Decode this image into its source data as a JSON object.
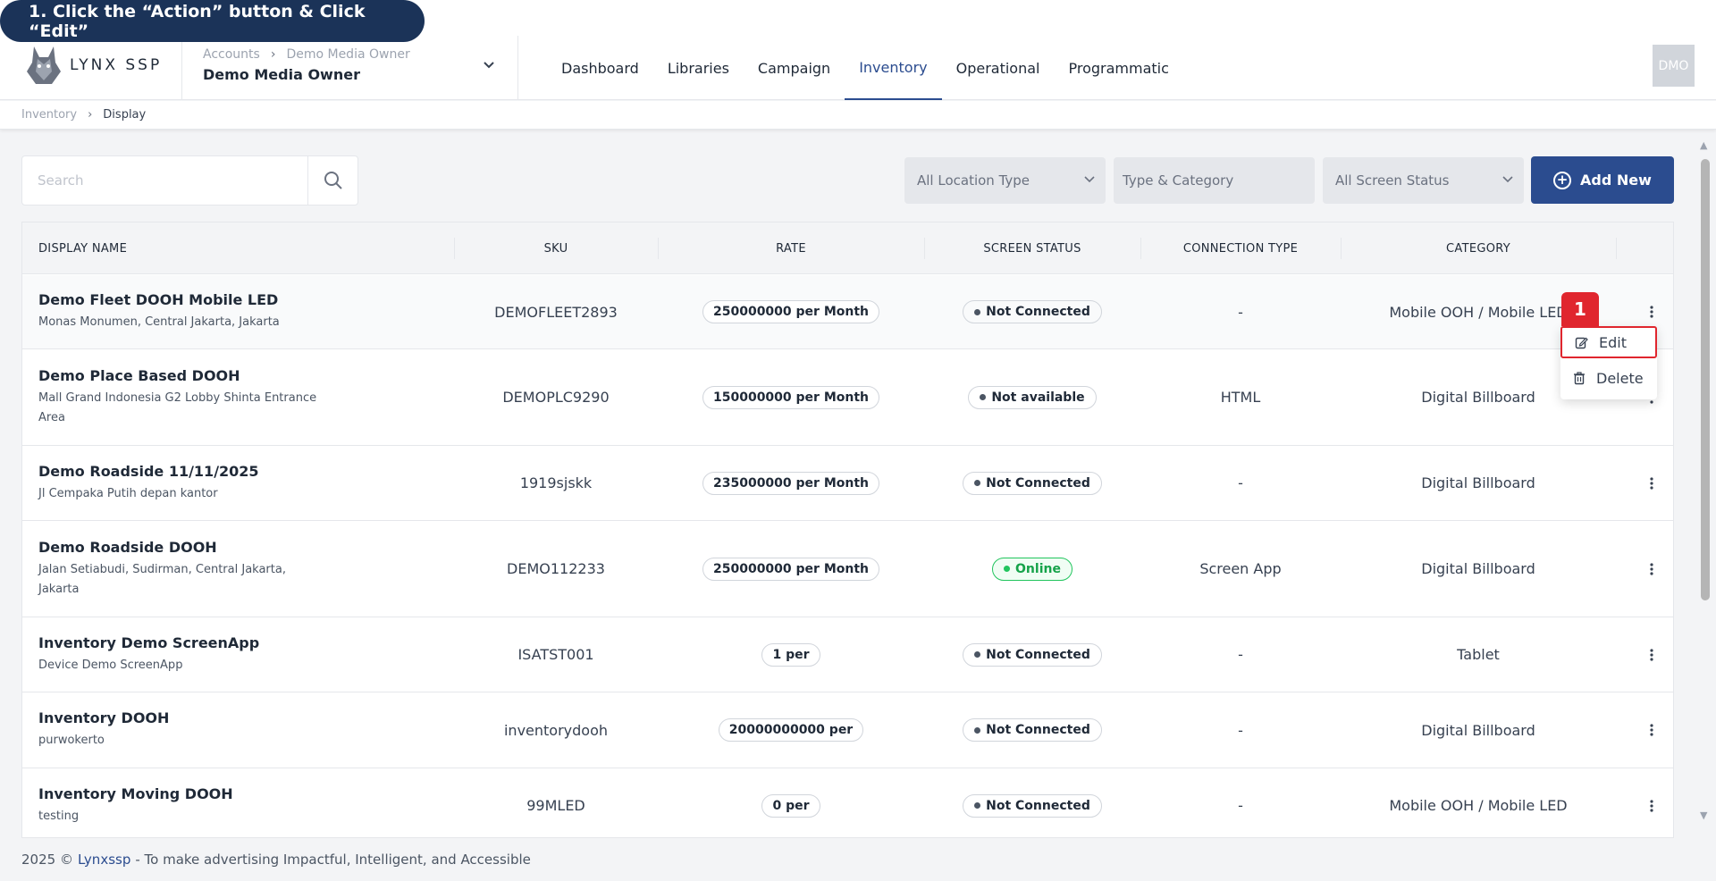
{
  "banner": {
    "text": "1. Click the “Action” button & Click “Edit”"
  },
  "header": {
    "logo_text": "LYNX SSP",
    "account_breadcrumb": [
      "Accounts",
      "Demo Media Owner"
    ],
    "account_name": "Demo Media Owner",
    "nav": [
      "Dashboard",
      "Libraries",
      "Campaign",
      "Inventory",
      "Operational",
      "Programmatic"
    ],
    "active_nav": "Inventory",
    "avatar_text": "DMO"
  },
  "breadcrumb": {
    "parent": "Inventory",
    "current": "Display"
  },
  "toolbar": {
    "search_placeholder": "Search",
    "filter_location": "All Location Type",
    "filter_category": "Type & Category",
    "filter_status": "All Screen Status",
    "add_new": "Add New"
  },
  "table": {
    "headers": [
      "DISPLAY NAME",
      "SKU",
      "RATE",
      "SCREEN STATUS",
      "CONNECTION TYPE",
      "CATEGORY"
    ],
    "rows": [
      {
        "name": "Demo Fleet DOOH Mobile LED",
        "location": "Monas Monumen, Central Jakarta, Jakarta",
        "sku": "DEMOFLEET2893",
        "rate": "250000000 per Month",
        "status": "Not Connected",
        "connection": "-",
        "category": "Mobile OOH / Mobile LED"
      },
      {
        "name": "Demo Place Based DOOH",
        "location": "Mall Grand Indonesia G2 Lobby Shinta Entrance Area",
        "sku": "DEMOPLC9290",
        "rate": "150000000 per Month",
        "status": "Not available",
        "connection": "HTML",
        "category": "Digital Billboard"
      },
      {
        "name": "Demo Roadside 11/11/2025",
        "location": "Jl Cempaka Putih depan kantor",
        "sku": "1919sjskk",
        "rate": "235000000 per Month",
        "status": "Not Connected",
        "connection": "-",
        "category": "Digital Billboard"
      },
      {
        "name": "Demo Roadside DOOH",
        "location": "Jalan Setiabudi, Sudirman, Central Jakarta, Jakarta",
        "sku": "DEMO112233",
        "rate": "250000000 per Month",
        "status": "Online",
        "connection": "Screen App",
        "category": "Digital Billboard"
      },
      {
        "name": "Inventory Demo ScreenApp",
        "location": "Device Demo ScreenApp",
        "sku": "ISATST001",
        "rate": "1 per",
        "status": "Not Connected",
        "connection": "-",
        "category": "Tablet"
      },
      {
        "name": "Inventory DOOH",
        "location": "purwokerto",
        "sku": "inventorydooh",
        "rate": "20000000000 per",
        "status": "Not Connected",
        "connection": "-",
        "category": "Digital Billboard"
      },
      {
        "name": "Inventory Moving DOOH",
        "location": "testing",
        "sku": "99MLED",
        "rate": "0 per",
        "status": "Not Connected",
        "connection": "-",
        "category": "Mobile OOH / Mobile LED"
      }
    ]
  },
  "action_menu": {
    "step_number": "1",
    "edit": "Edit",
    "delete": "Delete"
  },
  "footer": {
    "prefix": "2025 ©",
    "brand": "Lynxssp",
    "tagline": "- To make advertising Impactful, Intelligent, and Accessible"
  },
  "colors": {
    "primary": "#2b4c8f",
    "banner": "#1b3358",
    "highlight": "#e0262e",
    "online": "#22c55e"
  }
}
